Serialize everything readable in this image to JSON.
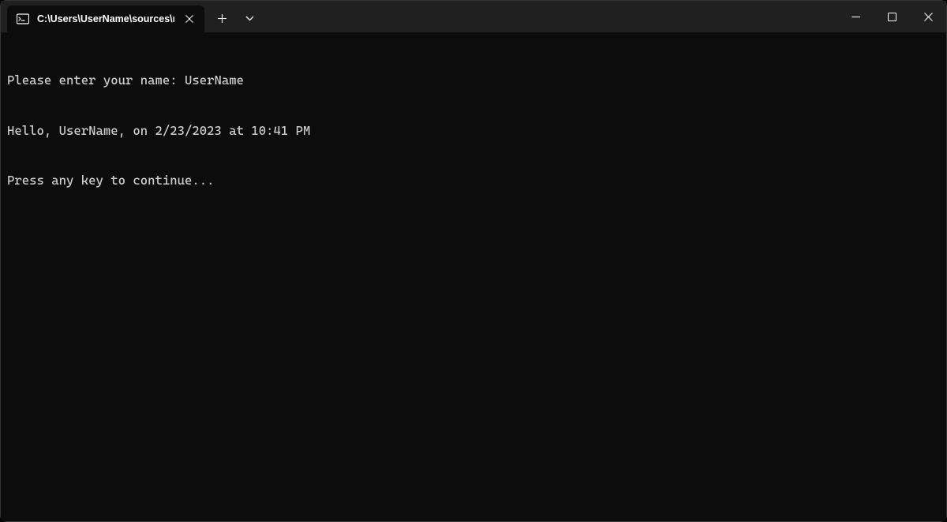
{
  "titlebar": {
    "tab": {
      "title": "C:\\Users\\UserName\\sources\\r",
      "icon_name": "terminal-icon"
    }
  },
  "terminal": {
    "lines": [
      "Please enter your name: UserName",
      "Hello, UserName, on 2/23/2023 at 10:41 PM",
      "Press any key to continue..."
    ]
  }
}
